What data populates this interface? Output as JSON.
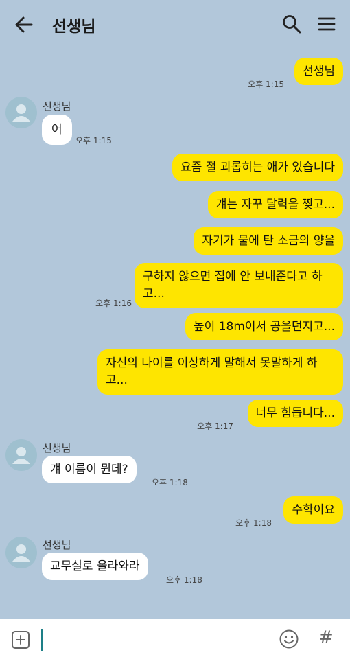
{
  "header": {
    "title": "선생님",
    "back_icon": "arrow-left-icon",
    "search_icon": "search-icon",
    "menu_icon": "menu-icon"
  },
  "messages": [
    {
      "from": "me",
      "text": "선생님",
      "time": "오후 1:15"
    },
    {
      "from": "other",
      "sender": "선생님",
      "text": "어",
      "time": "오후 1:15"
    },
    {
      "from": "me",
      "text": "요즘 절 괴롭히는 애가 있습니다"
    },
    {
      "from": "me",
      "text": "걔는 자꾸 달력을 찢고..."
    },
    {
      "from": "me",
      "text": "자기가 물에 탄 소금의 양을"
    },
    {
      "from": "me",
      "text": "구하지 않으면 집에 안 보내준다고 하고...",
      "time": "오후 1:16"
    },
    {
      "from": "me",
      "text": "높이 18m이서 공을던지고..."
    },
    {
      "from": "me",
      "text": "자신의 나이를 이상하게 말해서 못말하게 하고..."
    },
    {
      "from": "me",
      "text": "너무 힘듭니다...",
      "time": "오후 1:17"
    },
    {
      "from": "other",
      "sender": "선생님",
      "text": "걔 이름이 뭔데?",
      "time": "오후 1:18"
    },
    {
      "from": "me",
      "text": "수학이요",
      "time": "오후 1:18"
    },
    {
      "from": "other",
      "sender": "선생님",
      "text": "교무실로 올라와라",
      "time": "오후 1:18"
    }
  ],
  "composer": {
    "plus_icon": "plus-square-icon",
    "emoji_icon": "smiley-icon",
    "hash_label": "#"
  },
  "colors": {
    "background": "#b2c7da",
    "my_bubble": "#fee500",
    "their_bubble": "#ffffff",
    "cursor": "#1d7f87"
  }
}
